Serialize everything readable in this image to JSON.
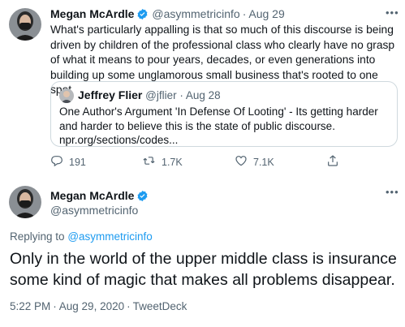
{
  "tweet1": {
    "author_name": "Megan McArdle",
    "handle": "@asymmetricinfo",
    "date": "Aug 29",
    "more": "•••",
    "text": "What's particularly appalling is that so much of this discourse is being driven by children of the professional class who clearly have no grasp of what it means to pour years,  decades, or even generations into building up some unglamorous small business that's rooted to one spot",
    "quote": {
      "author_name": "Jeffrey Flier",
      "handle": "@jflier",
      "date": "Aug 28",
      "text": "One Author's Argument 'In Defense Of Looting' - Its getting harder and harder to believe this is the state of public discourse.",
      "link": "npr.org/sections/codes..."
    },
    "actions": {
      "replies": "191",
      "retweets": "1.7K",
      "likes": "7.1K"
    }
  },
  "tweet2": {
    "author_name": "Megan McArdle",
    "handle": "@asymmetricinfo",
    "more": "•••",
    "replying_prefix": "Replying to",
    "replying_to": "@asymmetricinfo",
    "text": "Only in the world of the upper middle class is insurance some kind of magic that makes all problems disappear.",
    "time": "5:22 PM",
    "date": "Aug 29, 2020",
    "client": "TweetDeck"
  },
  "colors": {
    "accent": "#1d9bf0",
    "text": "#0f1419",
    "muted": "#536471",
    "border": "#cfd9de"
  },
  "icons": [
    "reply-icon",
    "retweet-icon",
    "like-icon",
    "share-icon",
    "verified-icon",
    "more-icon"
  ]
}
